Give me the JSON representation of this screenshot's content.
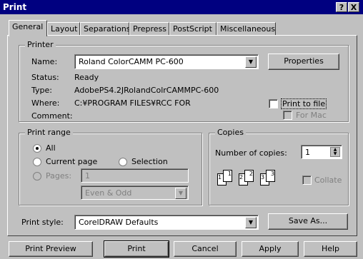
{
  "window": {
    "title": "Print",
    "help_glyph": "?",
    "close_glyph": "X"
  },
  "tabs": [
    {
      "label": "General",
      "active": true
    },
    {
      "label": "Layout"
    },
    {
      "label": "Separations"
    },
    {
      "label": "Prepress"
    },
    {
      "label": "PostScript"
    },
    {
      "label": "Miscellaneous"
    }
  ],
  "printer": {
    "legend": "Printer",
    "name_label": "Name:",
    "name_value": "Roland ColorCAMM PC-600",
    "properties_label": "Properties",
    "status_label": "Status:",
    "status_value": "Ready",
    "type_label": "Type:",
    "type_value": "AdobePS4.2JRolandColrCAMMPC-600",
    "where_label": "Where:",
    "where_value": "C:¥PROGRAM FILES¥RCC FOR",
    "comment_label": "Comment:",
    "print_to_file_label": "Print to file",
    "for_mac_label": "For Mac"
  },
  "print_range": {
    "legend": "Print range",
    "all_label": "All",
    "current_page_label": "Current page",
    "selection_label": "Selection",
    "pages_label": "Pages:",
    "pages_value": "1",
    "even_odd_value": "Even & Odd"
  },
  "copies": {
    "legend": "Copies",
    "number_label": "Number of copies:",
    "number_value": "1",
    "collate_label": "Collate",
    "page_numbers": [
      "1",
      "1",
      "2",
      "2",
      "3",
      "3"
    ]
  },
  "print_style": {
    "label": "Print style:",
    "value": "CorelDRAW Defaults",
    "save_as_label": "Save As..."
  },
  "buttons": {
    "print_preview": "Print Preview",
    "print": "Print",
    "cancel": "Cancel",
    "apply": "Apply",
    "help": "Help"
  }
}
